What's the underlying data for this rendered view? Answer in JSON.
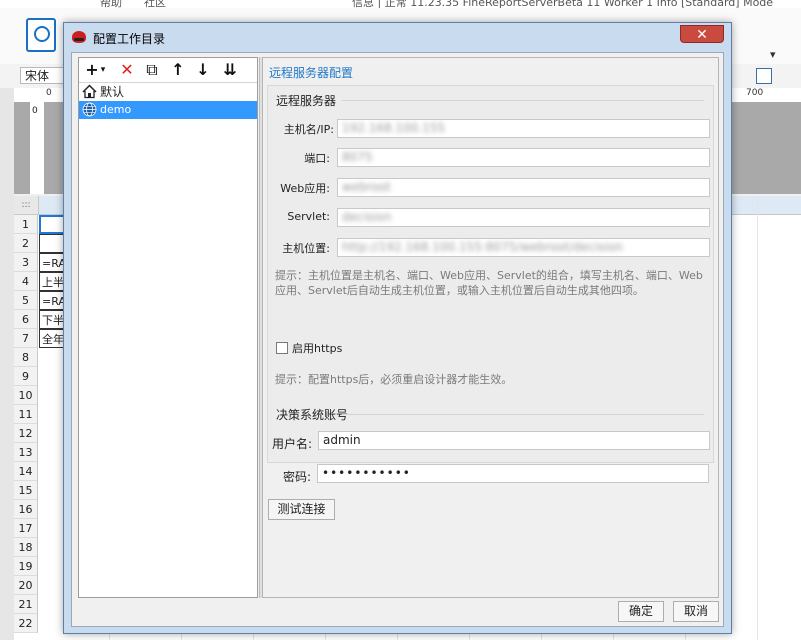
{
  "background": {
    "top_text": "信息 | 正常 11.23.35 FineReportServerBeta 11 Worker 1 Info [Standard] Mode",
    "menu_left": [
      "帮助",
      "社区"
    ],
    "font_name": "宋体",
    "ruler_labels": [
      "0",
      "700"
    ],
    "ruler_v_label": "0",
    "corner_label": ":::",
    "rows": [
      "1",
      "2",
      "3",
      "4",
      "5",
      "6",
      "7",
      "8",
      "9",
      "10",
      "11",
      "12",
      "13",
      "14",
      "15",
      "16",
      "17",
      "18",
      "19",
      "20",
      "21",
      "22"
    ],
    "cell_fragments": [
      "",
      "",
      "=RAN",
      "上半",
      "=RAN",
      "下半",
      "全年"
    ]
  },
  "dialog": {
    "title": "配置工作目录",
    "close_label": "✕",
    "toolbar": {
      "add": "+",
      "add_dropdown": "▾",
      "delete": "✕",
      "copy": "⧉",
      "move_up": "↑",
      "move_down": "↓",
      "sort": "⇊"
    },
    "tree": [
      {
        "label": "默认",
        "icon": "home-icon"
      },
      {
        "label": "demo",
        "icon": "globe-icon"
      }
    ],
    "section_title": "远程服务器配置",
    "remote_group_title": "远程服务器",
    "fields": {
      "host_label": "主机名/IP:",
      "host_value": "192.168.100.155",
      "port_label": "端口:",
      "port_value": "8075",
      "webapp_label": "Web应用:",
      "webapp_value": "webroot",
      "servlet_label": "Servlet:",
      "servlet_value": "decision",
      "location_label": "主机位置:",
      "location_value": "http://192.168.100.155:8075/webroot/decision"
    },
    "hint1": "提示：主机位置是主机名、端口、Web应用、Servlet的组合，填写主机名、端口、Web应用、Servlet后自动生成主机位置，或输入主机位置后自动生成其他四项。",
    "https_label": "启用https",
    "https_checked": false,
    "hint2": "提示：配置https后，必须重启设计器才能生效。",
    "account_group_title": "决策系统账号",
    "username_label": "用户名:",
    "username_value": "admin",
    "password_label": "密码:",
    "password_value": "•••••••••••",
    "test_button": "测试连接",
    "ok_button": "确定",
    "cancel_button": "取消"
  }
}
